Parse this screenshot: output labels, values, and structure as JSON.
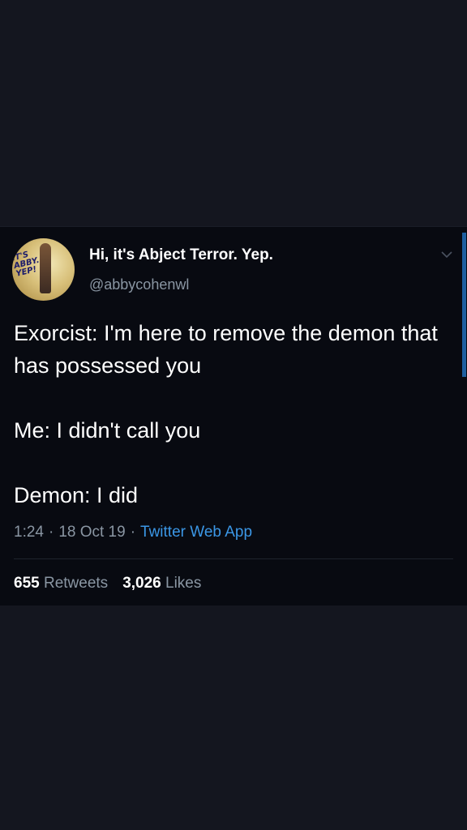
{
  "profile": {
    "display_name": "Hi, it's Abject Terror. Yep.",
    "handle": "@abbycohenwl",
    "avatar_text": "IT'S\nABBY.\nYEP!"
  },
  "tweet": {
    "lines": [
      "Exorcist: I'm here to remove the demon that has possessed you",
      "Me: I didn't call you",
      "Demon: I did"
    ],
    "time": "1:24",
    "date": "18 Oct 19",
    "source": "Twitter Web App",
    "separator": "·"
  },
  "stats": {
    "retweets_count": "655",
    "retweets_label": "Retweets",
    "likes_count": "3,026",
    "likes_label": "Likes"
  },
  "icons": {
    "more_menu": "chevron-down-icon"
  },
  "colors": {
    "background": "#14161f",
    "card": "#080a11",
    "text_primary": "#ffffff",
    "text_secondary": "#8a96a3",
    "link": "#3b97e6"
  }
}
